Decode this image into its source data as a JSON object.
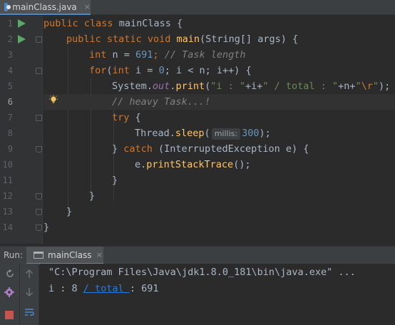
{
  "editor": {
    "tab": {
      "label": "mainClass.java",
      "close": "×",
      "icon": "java-class-icon"
    }
  },
  "gutter": {
    "line_numbers": [
      "1",
      "2",
      "3",
      "4",
      "5",
      "6",
      "7",
      "8",
      "9",
      "10",
      "11",
      "12",
      "13",
      "14"
    ],
    "current_line": 6
  },
  "code": {
    "l1": {
      "kw1": "public",
      "kw2": "class",
      "name": " mainClass {"
    },
    "l2": {
      "kw1": "public",
      "kw2": "static",
      "kw3": "void",
      "fn": "main",
      "rest": "(String[] args) {"
    },
    "l3": {
      "kw": "int",
      "pre": " n = ",
      "num": "691",
      "semi": ";",
      "cmt": " // Task length"
    },
    "l4": {
      "kw": "for",
      "p1": "(",
      "kw2": "int",
      "p2": " i = ",
      "num": "0",
      "p3": "; i < n; i++) {"
    },
    "l5": {
      "cls": "System.",
      "fld": "out",
      "dot": ".",
      "fn": "print",
      "p1": "(",
      "s1": "\"i : \"",
      "p2": "+i+",
      "s2": "\" / total : \"",
      "p3": "+n+",
      "s3": "\"",
      "esc": "\\r",
      "s4": "\"",
      "p4": ");"
    },
    "l6": {
      "cmt": "// heavy Task...!"
    },
    "l7": {
      "kw": "try",
      "rest": " {"
    },
    "l8": {
      "cls": "Thread.",
      "fn": "sleep",
      "p1": "(",
      "hint": "millis:",
      "num": "300",
      "p2": ");"
    },
    "l9": {
      "p1": "} ",
      "kw": "catch",
      "rest": " (InterruptedException e) {"
    },
    "l10": {
      "pre": "e.",
      "fn": "printStackTrace",
      "rest": "();"
    },
    "l11": {
      "text": "}"
    },
    "l12": {
      "text": "}"
    },
    "l13": {
      "text": "}"
    },
    "l14": {
      "text": "}"
    }
  },
  "run_panel": {
    "title": "Run:",
    "tab": {
      "label": "mainClass",
      "close": "×"
    },
    "console": {
      "line1": "\"C:\\Program Files\\Java\\jdk1.8.0_181\\bin\\java.exe\" ...",
      "line2_pre": "i : 8 ",
      "line2_link": "/ total ",
      "line2_post": ": 691"
    }
  },
  "colors": {
    "background": "#2b2b2b",
    "keyword": "#cc7832",
    "number": "#6897bb",
    "string": "#6a8759",
    "function": "#ffc66d",
    "field": "#9876aa",
    "comment": "#808080",
    "run_green": "#59a869",
    "link": "#287bde"
  }
}
